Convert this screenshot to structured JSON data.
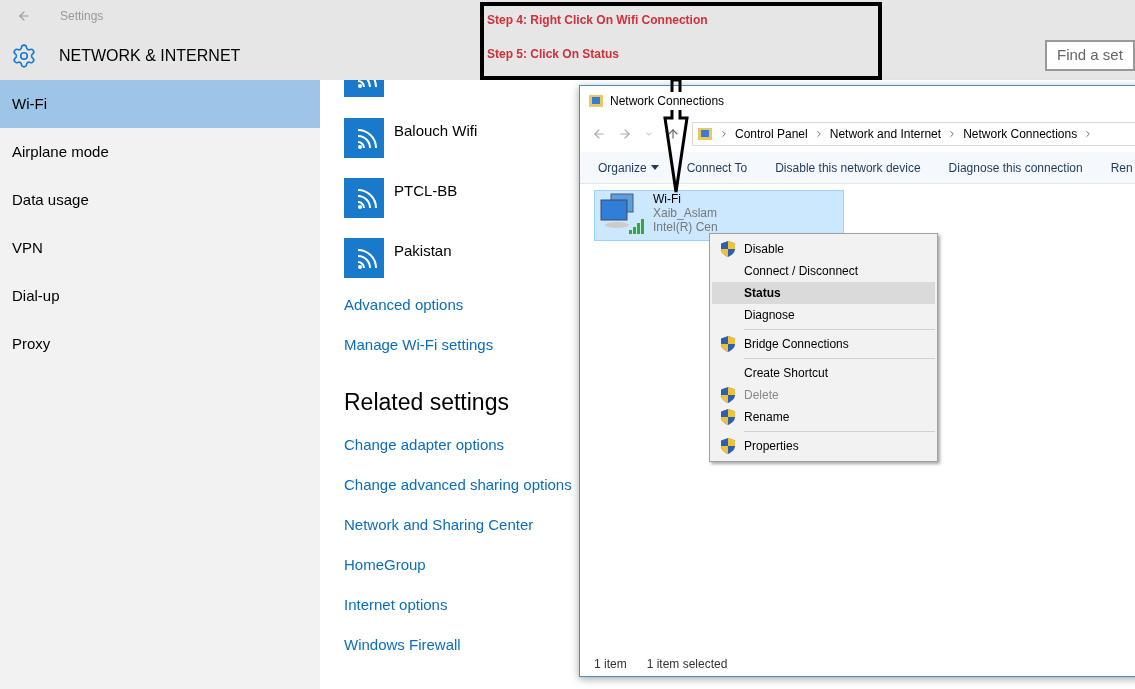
{
  "settings": {
    "title": "Settings",
    "section": "NETWORK & INTERNET",
    "search": {
      "placeholder": "Find a set"
    },
    "sidebar": [
      {
        "label": "Wi-Fi",
        "selected": true
      },
      {
        "label": "Airplane mode",
        "selected": false
      },
      {
        "label": "Data usage",
        "selected": false
      },
      {
        "label": "VPN",
        "selected": false
      },
      {
        "label": "Dial-up",
        "selected": false
      },
      {
        "label": "Proxy",
        "selected": false
      }
    ],
    "networks": [
      "Balouch Wifi",
      "PTCL-BB",
      "Pakistan"
    ],
    "links": [
      "Advanced options",
      "Manage Wi-Fi settings"
    ],
    "related_heading": "Related settings",
    "related_links": [
      "Change adapter options",
      "Change advanced sharing options",
      "Network and Sharing Center",
      "HomeGroup",
      "Internet options",
      "Windows Firewall"
    ]
  },
  "annotation": {
    "steps": [
      "Step 4: Right Click On Wifi Connection",
      "Step 5: Click On Status"
    ]
  },
  "explorer": {
    "title": "Network Connections",
    "breadcrumb": [
      "Control Panel",
      "Network and Internet",
      "Network Connections"
    ],
    "toolbar": [
      {
        "label": "Organize",
        "dropdown": true
      },
      {
        "label": "Connect To",
        "dropdown": false
      },
      {
        "label": "Disable this network device",
        "dropdown": false
      },
      {
        "label": "Diagnose this connection",
        "dropdown": false
      },
      {
        "label": "Ren",
        "dropdown": false
      }
    ],
    "connection": {
      "name": "Wi-Fi",
      "network": "Xaib_Aslam",
      "adapter": "Intel(R) Cen",
      "selected": true
    },
    "context_menu": [
      {
        "kind": "item",
        "label": "Disable",
        "shield": true,
        "disabled": false,
        "selected": false,
        "bold": false
      },
      {
        "kind": "item",
        "label": "Connect / Disconnect",
        "shield": false,
        "disabled": false,
        "selected": false,
        "bold": false
      },
      {
        "kind": "item",
        "label": "Status",
        "shield": false,
        "disabled": false,
        "selected": true,
        "bold": true
      },
      {
        "kind": "item",
        "label": "Diagnose",
        "shield": false,
        "disabled": false,
        "selected": false,
        "bold": false
      },
      {
        "kind": "separator"
      },
      {
        "kind": "item",
        "label": "Bridge Connections",
        "shield": true,
        "disabled": false,
        "selected": false,
        "bold": false
      },
      {
        "kind": "separator"
      },
      {
        "kind": "item",
        "label": "Create Shortcut",
        "shield": false,
        "disabled": false,
        "selected": false,
        "bold": false
      },
      {
        "kind": "item",
        "label": "Delete",
        "shield": true,
        "disabled": true,
        "selected": false,
        "bold": false
      },
      {
        "kind": "item",
        "label": "Rename",
        "shield": true,
        "disabled": false,
        "selected": false,
        "bold": false
      },
      {
        "kind": "separator"
      },
      {
        "kind": "item",
        "label": "Properties",
        "shield": true,
        "disabled": false,
        "selected": false,
        "bold": false
      }
    ],
    "status": [
      "1 item",
      "1 item selected"
    ]
  }
}
